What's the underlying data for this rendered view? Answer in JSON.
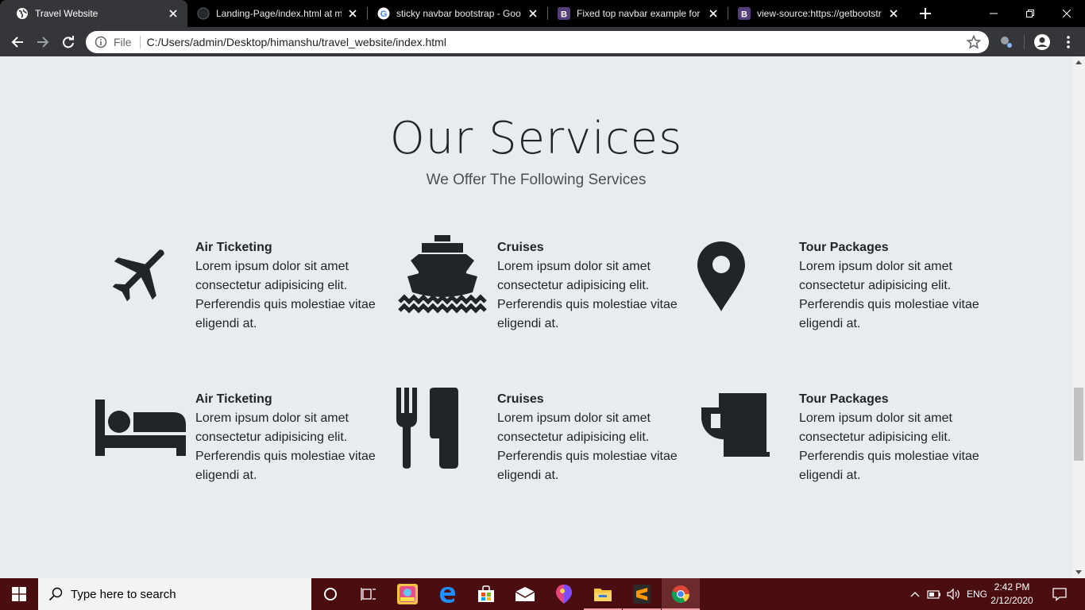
{
  "browser": {
    "tabs": [
      {
        "title": "Travel Website",
        "favicon": "globe-icon",
        "active": true
      },
      {
        "title": "Landing-Page/index.html at m",
        "favicon": "github-icon",
        "active": false
      },
      {
        "title": "sticky navbar bootstrap - Goo",
        "favicon": "google-icon",
        "active": false
      },
      {
        "title": "Fixed top navbar example for B",
        "favicon": "bootstrap-icon",
        "active": false
      },
      {
        "title": "view-source:https://getbootstr",
        "favicon": "bootstrap-icon",
        "active": false
      }
    ],
    "omnibox": {
      "scheme_label": "File",
      "url": "C:/Users/admin/Desktop/himanshu/travel_website/index.html"
    }
  },
  "page": {
    "heading": "Our Services",
    "subheading": "We Offer The Following Services",
    "services": [
      {
        "title": "Air Ticketing",
        "description": "Lorem ipsum dolor sit amet consectetur adipisicing elit. Perferendis quis molestiae vitae eligendi at.",
        "icon": "plane-icon"
      },
      {
        "title": "Cruises",
        "description": "Lorem ipsum dolor sit amet consectetur adipisicing elit. Perferendis quis molestiae vitae eligendi at.",
        "icon": "ship-icon"
      },
      {
        "title": "Tour Packages",
        "description": "Lorem ipsum dolor sit amet consectetur adipisicing elit. Perferendis quis molestiae vitae eligendi at.",
        "icon": "map-marker-icon"
      },
      {
        "title": "Air Ticketing",
        "description": "Lorem ipsum dolor sit amet consectetur adipisicing elit. Perferendis quis molestiae vitae eligendi at.",
        "icon": "bed-icon"
      },
      {
        "title": "Cruises",
        "description": "Lorem ipsum dolor sit amet consectetur adipisicing elit. Perferendis quis molestiae vitae eligendi at.",
        "icon": "utensils-icon"
      },
      {
        "title": "Tour Packages",
        "description": "Lorem ipsum dolor sit amet consectetur adipisicing elit. Perferendis quis molestiae vitae eligendi at.",
        "icon": "beer-mug-icon"
      }
    ]
  },
  "taskbar": {
    "search_placeholder": "Type here to search",
    "language": "ENG",
    "time": "2:42 PM",
    "date": "2/12/2020"
  },
  "colors": {
    "page_background": "#e9ecef",
    "text": "#212529",
    "taskbar": "#4a0e10",
    "chrome_toolbar": "#35363a"
  }
}
